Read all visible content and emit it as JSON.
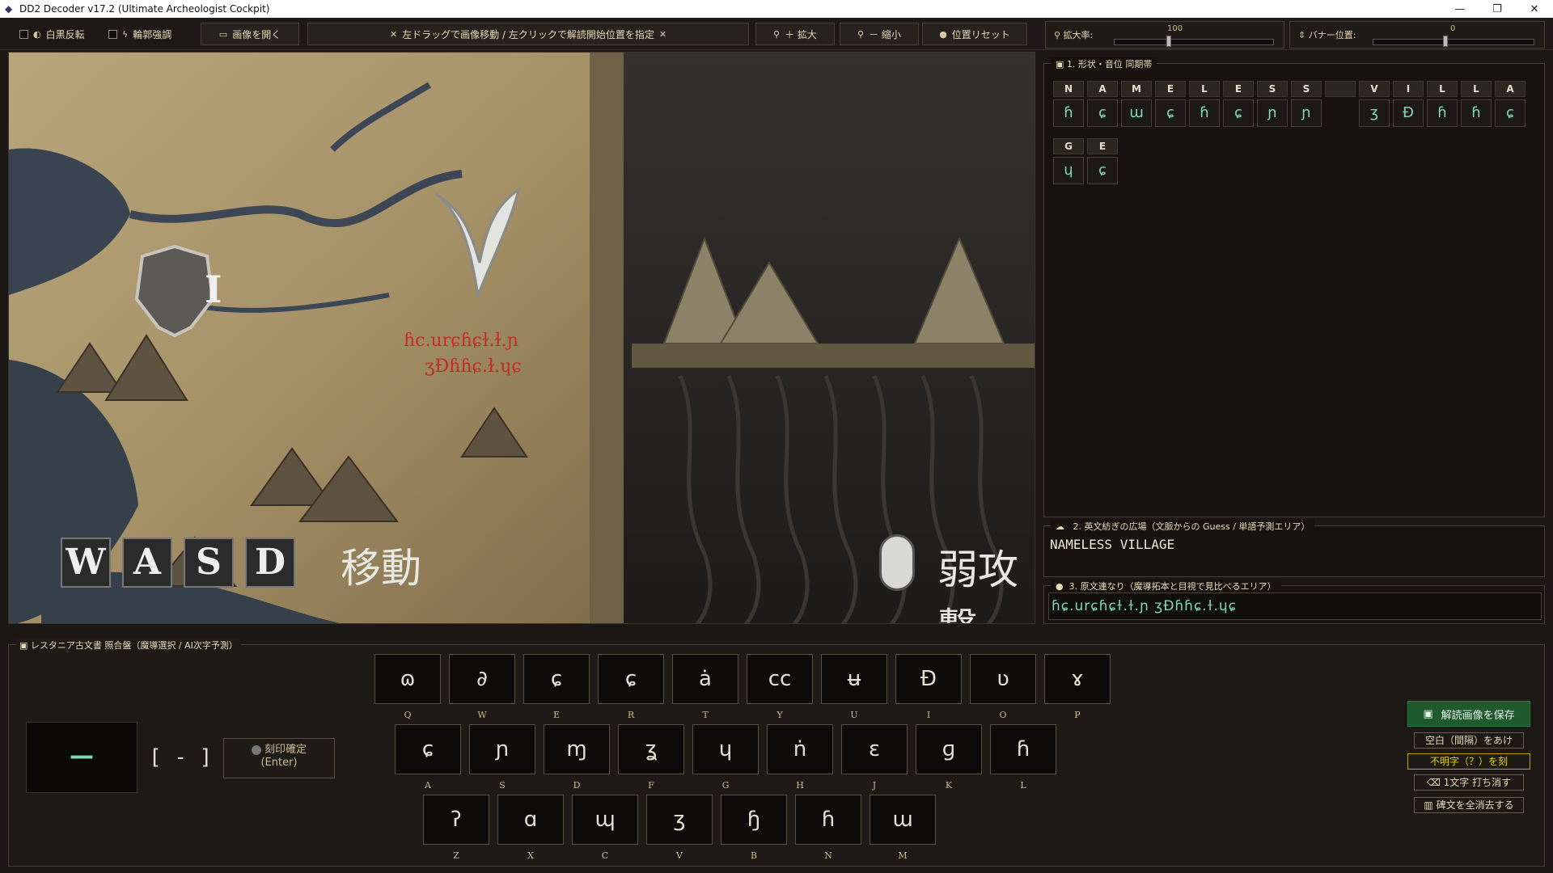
{
  "window": {
    "title": "DD2 Decoder v17.2 (Ultimate Archeologist Cockpit)",
    "minimize": "—",
    "restore": "❐",
    "close": "✕"
  },
  "toolbar": {
    "invert_label": "白黒反転",
    "edge_label": "輪郭強調",
    "open_label": "画像を開く",
    "hint_label": "左ドラッグで画像移動 / 左クリックで解読開始位置を指定",
    "zoom_in_label": "＋ 拡大",
    "zoom_out_label": "－ 縮小",
    "reset_label": "位置リセット",
    "zoom_rate_label": "拡大率:",
    "zoom_rate_value": "100",
    "zoom_fraction": 0.34,
    "banner_label": "バナー位置:",
    "banner_value": "0",
    "banner_fraction": 0.45
  },
  "map": {
    "wasd": [
      "W",
      "A",
      "S",
      "D"
    ],
    "move_label": "移動",
    "weak_attack_label": "弱攻撃",
    "marker_numeral": "I",
    "map_script_line1": "ɦc.urɕɦɕɫ.ɫ.ɲ",
    "map_script_line2": "ʒƉɦɦɕ.ɫ.ɥɕ"
  },
  "section1": {
    "title": "1. 形状・音位 同期帯",
    "row1": [
      {
        "letter": "N",
        "glyph": "ɦ"
      },
      {
        "letter": "A",
        "glyph": "ɕ"
      },
      {
        "letter": "M",
        "glyph": "ɯ"
      },
      {
        "letter": "E",
        "glyph": "ɕ"
      },
      {
        "letter": "L",
        "glyph": "ɦ"
      },
      {
        "letter": "E",
        "glyph": "ɕ"
      },
      {
        "letter": "S",
        "glyph": "ɲ"
      },
      {
        "letter": "S",
        "glyph": "ɲ"
      },
      {
        "letter": "",
        "glyph": ""
      },
      {
        "letter": "V",
        "glyph": "ʒ"
      },
      {
        "letter": "I",
        "glyph": "Ɖ"
      },
      {
        "letter": "L",
        "glyph": "ɦ"
      },
      {
        "letter": "L",
        "glyph": "ɦ"
      },
      {
        "letter": "A",
        "glyph": "ɕ"
      }
    ],
    "row2": [
      {
        "letter": "G",
        "glyph": "ɥ"
      },
      {
        "letter": "E",
        "glyph": "ɕ"
      }
    ]
  },
  "section2": {
    "title": "2. 英文紡ぎの広場（文脈からの Guess / 単語予測エリア）",
    "text": "NAMELESS VILLAGE"
  },
  "section3": {
    "title": "3. 原文連なり（魔導拓本と目視で見比べるエリア）",
    "text": "ɦɕ.urɕɦɕɫ.ɫ.ɲ ʒƉɦɦɕ.ɫ.ɥɕ"
  },
  "keyboard": {
    "title": "レスタニア古文書 照合盤（魔導選択 / AI次字予測）",
    "row1": [
      {
        "glyph": "ɷ",
        "key": "Q"
      },
      {
        "glyph": "∂",
        "key": "W"
      },
      {
        "glyph": "ɕ",
        "key": "E"
      },
      {
        "glyph": "ɕ",
        "key": "R"
      },
      {
        "glyph": "ȧ",
        "key": "T"
      },
      {
        "glyph": "cc",
        "key": "Y"
      },
      {
        "glyph": "ʉ",
        "key": "U"
      },
      {
        "glyph": "Ɖ",
        "key": "I"
      },
      {
        "glyph": "ʋ",
        "key": "O"
      },
      {
        "glyph": "ɤ",
        "key": "P"
      }
    ],
    "row2": [
      {
        "glyph": "ɕ",
        "key": "A"
      },
      {
        "glyph": "ɲ",
        "key": "S"
      },
      {
        "glyph": "ɱ",
        "key": "D"
      },
      {
        "glyph": "ʓ",
        "key": "F"
      },
      {
        "glyph": "ɥ",
        "key": "G"
      },
      {
        "glyph": "ṅ",
        "key": "H"
      },
      {
        "glyph": "ɛ",
        "key": "J"
      },
      {
        "glyph": "ɡ",
        "key": "K"
      },
      {
        "glyph": "ɦ",
        "key": "L"
      }
    ],
    "row3": [
      {
        "glyph": "ʔ",
        "key": "Z"
      },
      {
        "glyph": "ɑ",
        "key": "X"
      },
      {
        "glyph": "ɰ",
        "key": "C"
      },
      {
        "glyph": "ʒ",
        "key": "V"
      },
      {
        "glyph": "ɧ",
        "key": "B"
      },
      {
        "glyph": "ɦ",
        "key": "N"
      },
      {
        "glyph": "ɯ",
        "key": "M"
      }
    ],
    "preview": "—",
    "bracket_text": "[ - ]",
    "confirm_line1": "刻印確定",
    "confirm_line2": "(Enter)",
    "save_label": "解読画像を保存",
    "space_label": "空白（間隔）をあけ",
    "unknown_label": "不明字（？）を刻",
    "backspace_label": "1文字 打ち消す",
    "clear_label": "碑文を全消去する"
  }
}
